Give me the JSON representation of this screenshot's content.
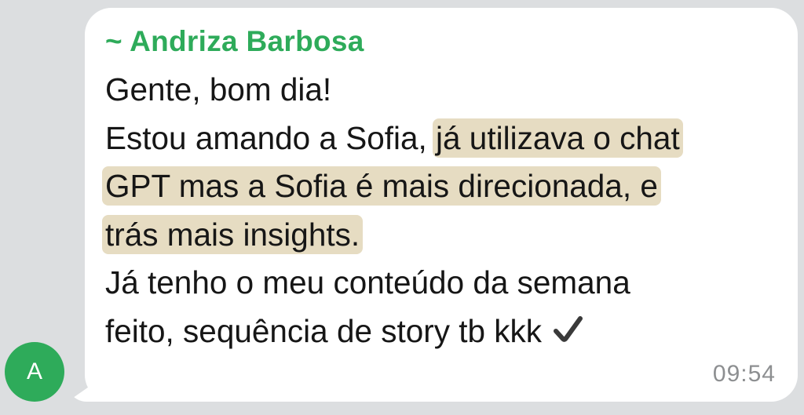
{
  "avatar": {
    "initial": "A",
    "color": "#2eab5a"
  },
  "message": {
    "sender": "~ Andriza Barbosa",
    "sender_color": "#2eab5a",
    "highlight_color": "#d9ceb0",
    "lines": [
      {
        "text": "Gente, bom dia!"
      },
      {
        "pre": "Estou amando a Sofia, ",
        "highlight": "já utilizava o chat"
      },
      {
        "highlight": "GPT mas a Sofia é mais direcionada, e"
      },
      {
        "highlight": "trás mais insights."
      },
      {
        "text": "Já tenho o meu conteúdo da semana"
      },
      {
        "text": "feito, sequência de story tb kkk"
      }
    ],
    "end_icon": "check-mark-icon",
    "time": "09:54"
  }
}
